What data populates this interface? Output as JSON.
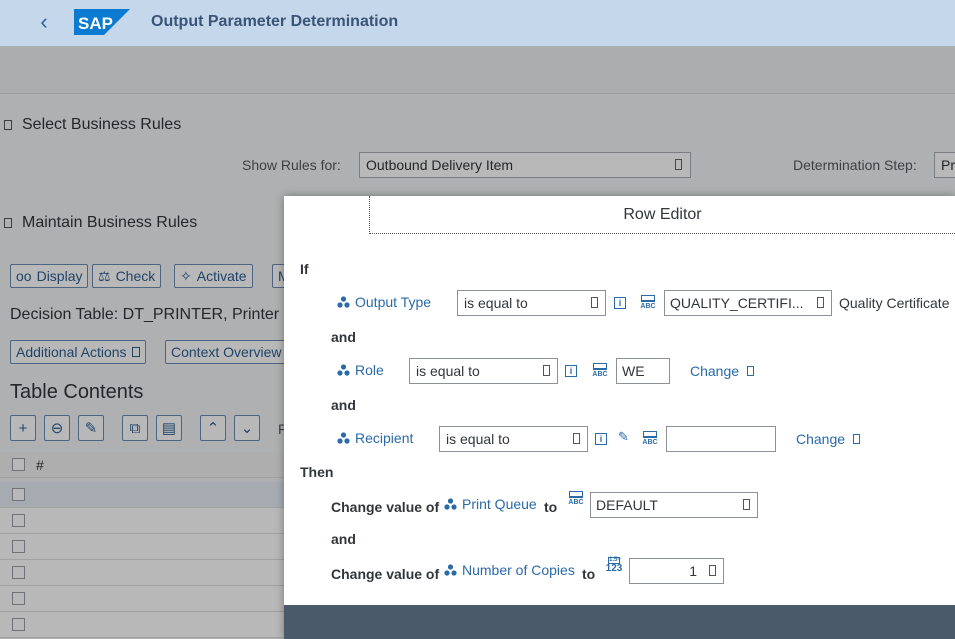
{
  "shell": {
    "title": "Output Parameter Determination",
    "logo": "SAP"
  },
  "background": {
    "select_rules": {
      "title": "Select Business Rules",
      "show_rules_label": "Show Rules for:",
      "show_rules_value": "Outbound Delivery Item",
      "determination_step_label": "Determination Step:",
      "determination_step_value": "Pr"
    },
    "maintain_rules": {
      "title": "Maintain Business Rules",
      "buttons": {
        "display": "Display",
        "check": "Check",
        "activate": "Activate",
        "more": "M"
      },
      "decision_table": "Decision Table: DT_PRINTER, Printer",
      "additional_actions": "Additional Actions",
      "context_overview": "Context Overview",
      "table_contents": "Table Contents",
      "col_hash": "#",
      "filter_letter": "F"
    }
  },
  "dialog": {
    "title": "Row Editor",
    "if": "If",
    "and": "and",
    "then": "Then",
    "conditions": [
      {
        "attribute": "Output Type",
        "operator": "is equal to",
        "value": "QUALITY_CERTIFI...",
        "description": "Quality Certificate"
      },
      {
        "attribute": "Role",
        "operator": "is equal to",
        "value": "WE",
        "change": "Change"
      },
      {
        "attribute": "Recipient",
        "operator": "is equal to",
        "value": "",
        "change": "Change"
      }
    ],
    "actions": [
      {
        "prefix": "Change value of",
        "attribute": "Print Queue",
        "to": "to",
        "value": "DEFAULT"
      },
      {
        "prefix": "Change value of",
        "attribute": "Number of Copies",
        "to": "to",
        "value": "1"
      }
    ],
    "type_icons": {
      "abc_top": "••••",
      "abc_bottom": "ABC",
      "num_top": "1.5+",
      "num_bottom": "123",
      "info": "i"
    }
  }
}
